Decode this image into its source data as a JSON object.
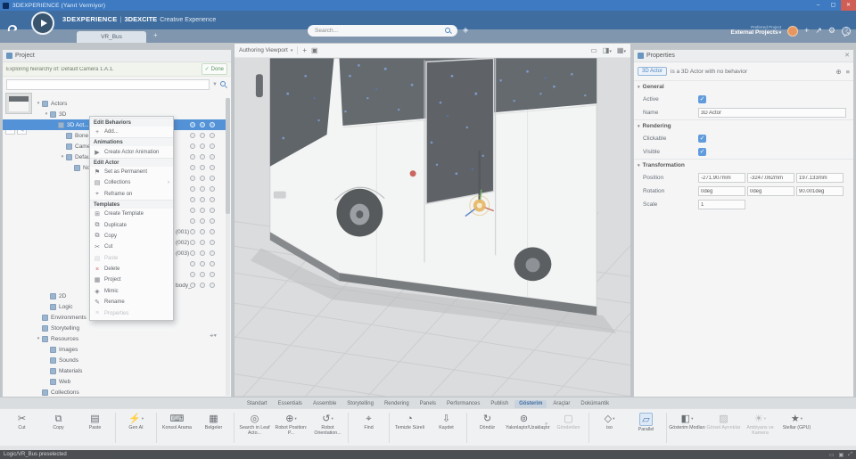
{
  "titlebar": {
    "title": "3DEXPERIENCE (Yanıt Vermiyor)",
    "minimize": "–",
    "maximize": "▢",
    "close": "✕"
  },
  "header": {
    "brand": "3DEXPERIENCE",
    "divider": "|",
    "app": "3DEXCITE",
    "app_suffix": "Creative Experience",
    "search_placeholder": "Search...",
    "project_caption": "Preferred Project",
    "project_selector": "External Projects"
  },
  "tabbar": {
    "tabs": [
      {
        "label": "VR_Bus",
        "active": true
      }
    ],
    "add_label": "+"
  },
  "left_panel": {
    "title": "Project",
    "hierarchy_note": "Exploring hierarchy of: Default Camera 1.A.1.",
    "done_label": "Done",
    "tree": [
      {
        "label": "Actors",
        "depth": 0,
        "expander": "open"
      },
      {
        "label": "3D",
        "depth": 1,
        "expander": "open"
      },
      {
        "label": "3D Act...",
        "depth": 2,
        "selected": true,
        "icons": true
      },
      {
        "label": "Bone B...",
        "depth": 3,
        "icons": true
      },
      {
        "label": "Camera...",
        "depth": 3,
        "icons": true
      },
      {
        "label": "Default ...",
        "depth": 3,
        "expander": "open",
        "icons": true
      },
      {
        "label": "No...",
        "depth": 4,
        "icons": true
      },
      {
        "label": "",
        "icons": true
      },
      {
        "label": "",
        "icons": true
      },
      {
        "label": "",
        "icons": true
      },
      {
        "label": "",
        "icons": true
      },
      {
        "label": "",
        "icons": true
      },
      {
        "label": "(001)",
        "peek": true,
        "icons": true
      },
      {
        "label": "(002)",
        "peek": true,
        "icons": true
      },
      {
        "label": "(003)",
        "peek": true,
        "icons": true
      },
      {
        "label": "",
        "icons": true
      },
      {
        "label": "",
        "icons": true
      },
      {
        "label": "body_D",
        "peek": true,
        "icons": true
      },
      {
        "label": "2D",
        "depth": 1
      },
      {
        "label": "Logic",
        "depth": 1
      },
      {
        "label": "Environments",
        "depth": 0
      },
      {
        "label": "Storytelling",
        "depth": 0
      },
      {
        "label": "Resources",
        "depth": 0,
        "expander": "open"
      },
      {
        "label": "Images",
        "depth": 1
      },
      {
        "label": "Sounds",
        "depth": 1
      },
      {
        "label": "Materials",
        "depth": 1
      },
      {
        "label": "Web",
        "depth": 1
      },
      {
        "label": "Collections",
        "depth": 0
      }
    ]
  },
  "context_menu": {
    "items": [
      {
        "kind": "header",
        "label": "Edit Behaviors"
      },
      {
        "kind": "item",
        "label": "Add...",
        "icon": "plus"
      },
      {
        "kind": "header",
        "label": "Animations"
      },
      {
        "kind": "item",
        "label": "Create Actor Animation",
        "icon": "animation"
      },
      {
        "kind": "header",
        "label": "Edit Actor"
      },
      {
        "kind": "item",
        "label": "Set as Permanent",
        "icon": "pin"
      },
      {
        "kind": "item",
        "label": "Collections",
        "icon": "collections",
        "submenu": true
      },
      {
        "kind": "item",
        "label": "Reframe on",
        "icon": "reframe"
      },
      {
        "kind": "header",
        "label": "Templates"
      },
      {
        "kind": "item",
        "label": "Create Template",
        "icon": "template"
      },
      {
        "kind": "item",
        "label": "Duplicate",
        "icon": "duplicate"
      },
      {
        "kind": "item",
        "label": "Copy",
        "icon": "copy"
      },
      {
        "kind": "item",
        "label": "Cut",
        "icon": "cut"
      },
      {
        "kind": "item",
        "label": "Paste",
        "icon": "paste",
        "disabled": true
      },
      {
        "kind": "item",
        "label": "Delete",
        "icon": "delete",
        "danger": true
      },
      {
        "kind": "item",
        "label": "Project",
        "icon": "project"
      },
      {
        "kind": "item",
        "label": "Mimic",
        "icon": "mimic"
      },
      {
        "kind": "item",
        "label": "Rename",
        "icon": "rename"
      },
      {
        "kind": "item",
        "label": "Properties",
        "icon": "properties",
        "disabled": true
      }
    ]
  },
  "viewport": {
    "selector_label": "Authoring Viewport"
  },
  "properties": {
    "title": "Properties",
    "badge": "3D Actor",
    "description": "is a 3D Actor with no behavior",
    "sections": {
      "general": {
        "label": "General",
        "active_label": "Active",
        "name_label": "Name",
        "name_value": "3D Actor"
      },
      "rendering": {
        "label": "Rendering",
        "clickable_label": "Clickable",
        "visible_label": "Visible"
      },
      "transformation": {
        "label": "Transformation",
        "position_label": "Position",
        "rotation_label": "Rotation",
        "scale_label": "Scale",
        "position": [
          "-271.907mm",
          "-3247.062mm",
          "197.133mm"
        ],
        "rotation": [
          "0deg",
          "0deg",
          "90.001deg"
        ],
        "scale": "1"
      }
    }
  },
  "ribbon": {
    "tabs": [
      {
        "label": "Standart"
      },
      {
        "label": "Essentials"
      },
      {
        "label": "Assemble"
      },
      {
        "label": "Storytelling"
      },
      {
        "label": "Rendering"
      },
      {
        "label": "Panels"
      },
      {
        "label": "Performances"
      },
      {
        "label": "Publish"
      },
      {
        "label": "Gösterim",
        "active": true
      },
      {
        "label": "Araçlar"
      },
      {
        "label": "Dokümantik"
      }
    ]
  },
  "toolbar": {
    "items": [
      {
        "label": "Cut",
        "icon": "cut"
      },
      {
        "label": "Copy",
        "icon": "copy"
      },
      {
        "label": "Paste",
        "icon": "paste"
      },
      {
        "kind": "sep"
      },
      {
        "label": "Gen AI",
        "icon": "genai",
        "dropdown": true
      },
      {
        "kind": "sep"
      },
      {
        "label": "Konsol Arama",
        "icon": "console"
      },
      {
        "label": "Belgeler",
        "icon": "docs"
      },
      {
        "kind": "sep"
      },
      {
        "label": "Search in Leaf Acto...",
        "icon": "searchleaf"
      },
      {
        "label": "Robot Position: P...",
        "icon": "robotpos",
        "dropdown": true
      },
      {
        "label": "Robot Orientation...",
        "icon": "robotorient",
        "dropdown": true
      },
      {
        "kind": "sep"
      },
      {
        "label": "Find",
        "icon": "find"
      },
      {
        "kind": "sep"
      },
      {
        "label": "Temizle Süreli",
        "icon": "timer"
      },
      {
        "label": "Kaydet",
        "icon": "save"
      },
      {
        "kind": "sep"
      },
      {
        "label": "Döndür",
        "icon": "rotate"
      },
      {
        "label": "Yakınlaştır/Uzaklaştır",
        "icon": "zoom"
      },
      {
        "kind": "chevron"
      },
      {
        "label": "Gönderilen",
        "icon": "box",
        "disabled": true
      },
      {
        "kind": "sep"
      },
      {
        "label": "iso",
        "icon": "iso",
        "dropdown": true
      },
      {
        "label": "Parallel",
        "icon": "parallel",
        "active": true
      },
      {
        "kind": "sep"
      },
      {
        "label": "Gösterim Modları",
        "icon": "dispmodes",
        "dropdown": true
      },
      {
        "label": "Görsel Ayrıntılar",
        "icon": "visdetails",
        "disabled": true
      },
      {
        "label": "Ambiyans ve Kamera",
        "icon": "ambience",
        "disabled": true,
        "dropdown": true
      },
      {
        "label": "Stellar (GPU)",
        "icon": "stellar",
        "dropdown": true
      }
    ]
  },
  "statusbar": {
    "text": "Logic/VR_Bus preselected"
  },
  "icon_glyphs": {
    "plus": "+",
    "animation": "▶",
    "pin": "⚑",
    "collections": "▤",
    "reframe": "⌖",
    "template": "⊞",
    "duplicate": "⧉",
    "copy": "⧉",
    "cut": "✂",
    "paste": "▤",
    "delete": "×",
    "project": "▦",
    "mimic": "◈",
    "rename": "✎",
    "properties": "≡",
    "genai": "⚡",
    "console": "⌨",
    "docs": "▦",
    "searchleaf": "◎",
    "robotpos": "⊕",
    "robotorient": "↺",
    "find": "⌖",
    "timer": "◔",
    "save": "⇩",
    "rotate": "↻",
    "zoom": "⊚",
    "box": "▢",
    "iso": "◇",
    "parallel": "▱",
    "dispmodes": "◧",
    "visdetails": "▨",
    "ambience": "☀",
    "stellar": "★"
  },
  "colors": {
    "titlebar": "#3d7ac1",
    "header": "#164f8b",
    "selection": "#2f7cd0",
    "badge_blue": "#2a6cb4",
    "done_green": "#2e7d3a",
    "delete_red": "#c23b32",
    "avatar_orange": "#e2813c",
    "checkbox_blue": "#3f87d6"
  }
}
